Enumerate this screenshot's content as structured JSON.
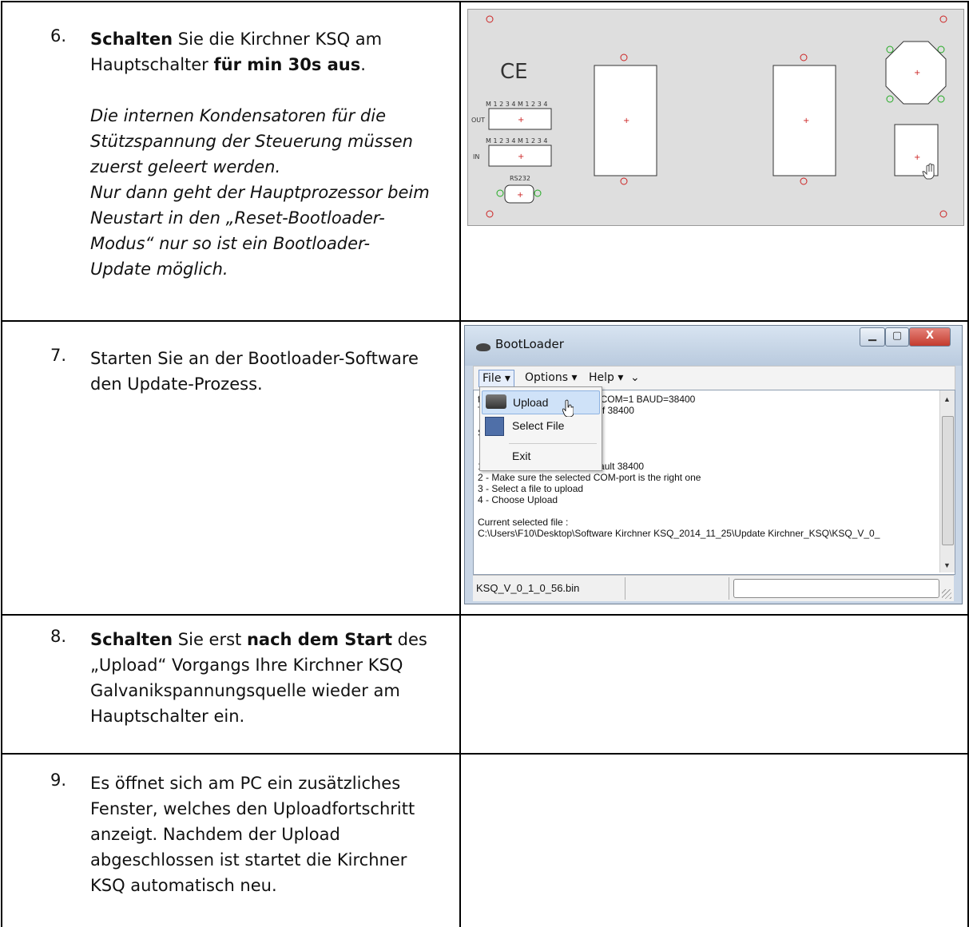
{
  "steps": [
    {
      "number": "6.",
      "lines": [
        [
          "Schalten",
          " Sie die Kirchner KSQ am"
        ],
        [
          "Hauptschalter ",
          "für min 30s aus",
          "."
        ]
      ],
      "italic": [
        "Die internen Kondensatoren für die",
        "Stützspannung der Steuerung müssen",
        "zuerst geleert werden.",
        "Nur dann geht der Hauptprozessor beim",
        "Neustart in den „Reset-Bootloader-",
        "Modus“ nur so ist ein Bootloader-",
        "Update möglich."
      ]
    },
    {
      "number": "7.",
      "text": [
        "Starten Sie an der Bootloader-Software",
        "den Update-Prozess."
      ]
    },
    {
      "number": "8.",
      "b1": "Schalten",
      "t1": " Sie erst ",
      "b2": "nach dem Start",
      "t2": " des",
      "lines": [
        "„Upload“ Vorgangs Ihre Kirchner KSQ",
        "Galvanikspannungsquelle wieder am",
        "Hauptschalter ein."
      ]
    },
    {
      "number": "9.",
      "text": [
        "Es öffnet sich am PC ein zusätzliches",
        "Fenster, welches den Uploadfortschritt",
        "anzeigt. Nachdem der Upload",
        "abgeschlossen ist startet die Kirchner",
        "KSQ automatisch neu."
      ]
    }
  ],
  "panel": {
    "ce_mark": "CE",
    "row_labels": [
      "M 1 2 3 4 M 1 2 3 4",
      "M 1 2 3 4 M 1 2 3 4"
    ],
    "out_label": "OUT",
    "in_label": "IN",
    "rs232_label": "RS232"
  },
  "bootloader": {
    "title": "BootLoader",
    "menu": {
      "file": "File ▾",
      "options": "Options ▾",
      "help": "Help ▾",
      "overflow": "⌄"
    },
    "dropdown": {
      "upload": "Upload",
      "select_file": "Select File",
      "exit": "Exit"
    },
    "lines": [
      "fi                           EN7.BIN\"  COM=1 BAUD=38400",
      "T                           AUD rate of 38400",
      "",
      "S",
      "",
      "",
      "1                               te is default 38400",
      "2 - Make sure the selected COM-port is the right one",
      "3 - Select a file to upload",
      "4 - Choose Upload",
      "",
      "Current selected file :",
      "C:\\Users\\F10\\Desktop\\Software Kirchner KSQ_2014_11_25\\Update Kirchner_KSQ\\KSQ_V_0_"
    ],
    "status_file": "KSQ_V_0_1_0_56.bin",
    "buttons": {
      "minimize": "▁",
      "maximize": "▢",
      "close": "X"
    }
  }
}
